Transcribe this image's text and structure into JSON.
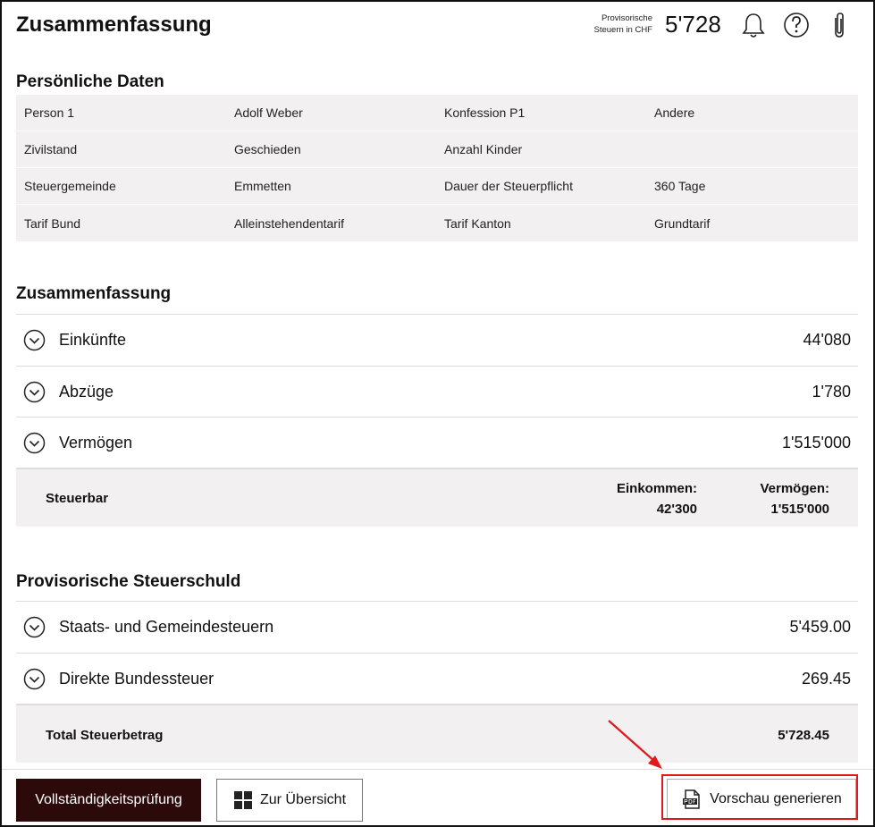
{
  "header": {
    "title": "Zusammenfassung",
    "prov_label_line1": "Provisorische",
    "prov_label_line2": "Steuern in CHF",
    "prov_value": "5'728",
    "icons": [
      "bell-icon",
      "help-icon",
      "paperclip-icon"
    ]
  },
  "personal": {
    "title": "Persönliche Daten",
    "rows": [
      [
        "Person 1",
        "Adolf Weber",
        "Konfession P1",
        "Andere"
      ],
      [
        "Zivilstand",
        "Geschieden",
        "Anzahl Kinder",
        ""
      ],
      [
        "Steuergemeinde",
        "Emmetten",
        "Dauer der Steuerpflicht",
        "360 Tage"
      ],
      [
        "Tarif Bund",
        "Alleinstehendentarif",
        "Tarif Kanton",
        "Grundtarif"
      ]
    ]
  },
  "summary": {
    "title": "Zusammenfassung",
    "rows": [
      {
        "label": "Einkünfte",
        "value": "44'080"
      },
      {
        "label": "Abzüge",
        "value": "1'780"
      },
      {
        "label": "Vermögen",
        "value": "1'515'000"
      }
    ],
    "taxable": {
      "label": "Steuerbar",
      "income_label": "Einkommen:",
      "income_value": "42'300",
      "wealth_label": "Vermögen:",
      "wealth_value": "1'515'000"
    }
  },
  "debt": {
    "title": "Provisorische Steuerschuld",
    "rows": [
      {
        "label": "Staats- und Gemeindesteuern",
        "value": "5'459.00"
      },
      {
        "label": "Direkte Bundessteuer",
        "value": "269.45"
      }
    ],
    "total_label": "Total Steuerbetrag",
    "total_value": "5'728.45"
  },
  "footer": {
    "check_label": "Vollständigkeitsprüfung",
    "overview_label": "Zur Übersicht",
    "preview_label": "Vorschau generieren"
  },
  "colors": {
    "primary": "#2d0a0a",
    "panel": "#f2f0f0",
    "highlight": "#e0191c"
  }
}
